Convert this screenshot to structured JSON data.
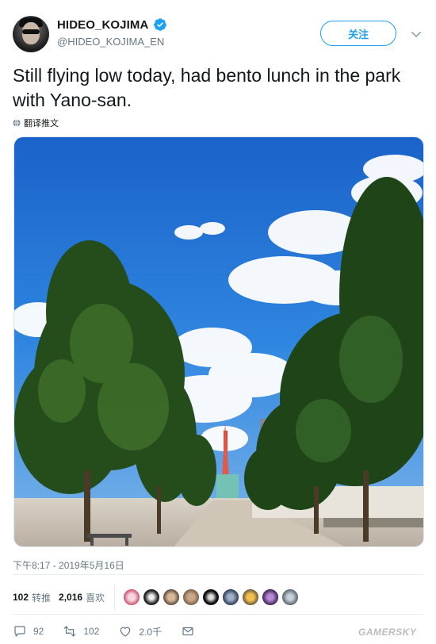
{
  "header": {
    "display_name": "HIDEO_KOJIMA",
    "handle": "@HIDEO_KOJIMA_EN",
    "follow_label": "关注"
  },
  "tweet": {
    "text": "Still flying low today, had bento lunch in the park with Yano-san.",
    "translate_label": "翻译推文",
    "timestamp": "下午8:17 - 2019年5月16日"
  },
  "stats": {
    "retweets_count": "102",
    "retweets_label": "转推",
    "likes_count": "2,016",
    "likes_label": "喜欢",
    "liker_avatars": 9
  },
  "actions": {
    "reply_count": "92",
    "retweet_count": "102",
    "like_count": "2.0千"
  },
  "watermark": "GAMERSKY",
  "colors": {
    "accent": "#1da1f2",
    "muted": "#657786",
    "text": "#14171a"
  }
}
